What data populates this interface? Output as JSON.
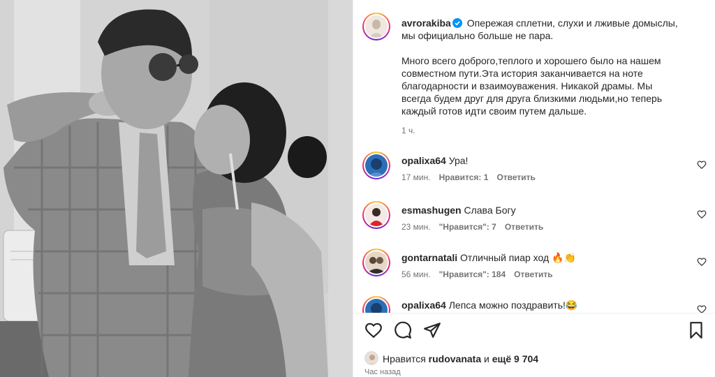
{
  "post": {
    "author": "avrorakiba",
    "caption_lines_1": [
      "Опережая сплетни, слухи и лживые домыслы,",
      "мы официально больше не пара."
    ],
    "caption_lines_2": [
      "Много всего доброго,теплого и хорошего было на нашем",
      "совместном пути.Эта история заканчивается на ноте",
      "благодарности и взаимоуважения. Никакой драмы. Мы",
      "всегда будем друг для друга близкими людьми,но теперь",
      "каждый готов идти своим путем дальше."
    ],
    "caption_time": "1 ч."
  },
  "comments": [
    {
      "user": "opalixa64",
      "text": "Ура!",
      "time": "17 мин.",
      "likes": "Нравится: 1",
      "likes_bold": true,
      "reply": "Ответить"
    },
    {
      "user": "esmashugen",
      "text": "Слава Богу",
      "time": "23 мин.",
      "likes": "\"Нравится\": 7",
      "likes_bold": true,
      "reply": "Ответить"
    },
    {
      "user": "gontarnatali",
      "text": "Отличный пиар ход 🔥👏",
      "time": "56 мин.",
      "likes": "\"Нравится\": 184",
      "likes_bold": true,
      "reply": "Ответить"
    },
    {
      "user": "opalixa64",
      "text": "Лепса можно поздравить!😂",
      "time": "",
      "likes": "",
      "likes_bold": false,
      "reply": ""
    }
  ],
  "likes": {
    "prefix": "Нравится",
    "user": "rudovanata",
    "middle": "и",
    "count": "ещё 9 704"
  },
  "time_ago": "Час назад",
  "icons": {
    "like": "heart-icon",
    "comment": "comment-icon",
    "share": "share-icon",
    "save": "bookmark-icon",
    "verified": "verified-badge-icon"
  },
  "colors": {
    "text": "#262626",
    "muted": "#737373",
    "verified": "#0095f6"
  }
}
